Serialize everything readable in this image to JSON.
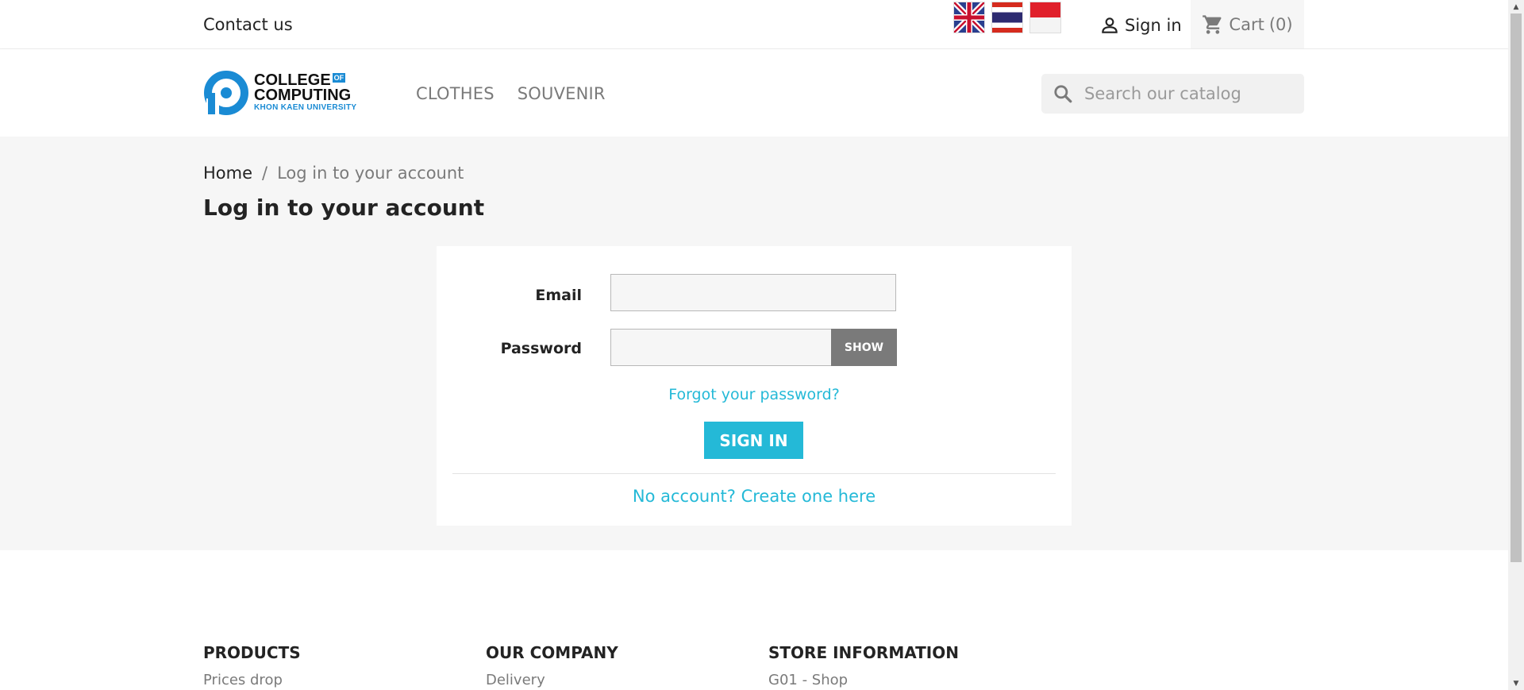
{
  "topbar": {
    "contact_label": "Contact us",
    "languages": [
      "English",
      "Thai",
      "Indonesian"
    ],
    "signin_label": "Sign in",
    "cart_label": "Cart",
    "cart_count": "(0)"
  },
  "header": {
    "logo": {
      "line1": "COLLEGE",
      "of": "OF",
      "line2": "COMPUTING",
      "line3": "KHON KAEN UNIVERSITY"
    },
    "nav": [
      "CLOTHES",
      "SOUVENIR"
    ],
    "search_placeholder": "Search our catalog"
  },
  "breadcrumb": {
    "home": "Home",
    "separator": "/",
    "current": "Log in to your account"
  },
  "page_title": "Log in to your account",
  "form": {
    "email_label": "Email",
    "email_value": "",
    "password_label": "Password",
    "password_value": "",
    "show_label": "SHOW",
    "forgot_label": "Forgot your password?",
    "signin_label": "SIGN IN",
    "create_label": "No account? Create one here"
  },
  "footer": {
    "columns": [
      {
        "title": "PRODUCTS",
        "first_link": "Prices drop"
      },
      {
        "title": "OUR COMPANY",
        "first_link": "Delivery"
      },
      {
        "title": "STORE INFORMATION",
        "first_link": "G01 - Shop"
      }
    ]
  },
  "colors": {
    "accent": "#24b9d7",
    "main_bg": "#f6f6f6",
    "show_button": "#7a7a7a"
  }
}
